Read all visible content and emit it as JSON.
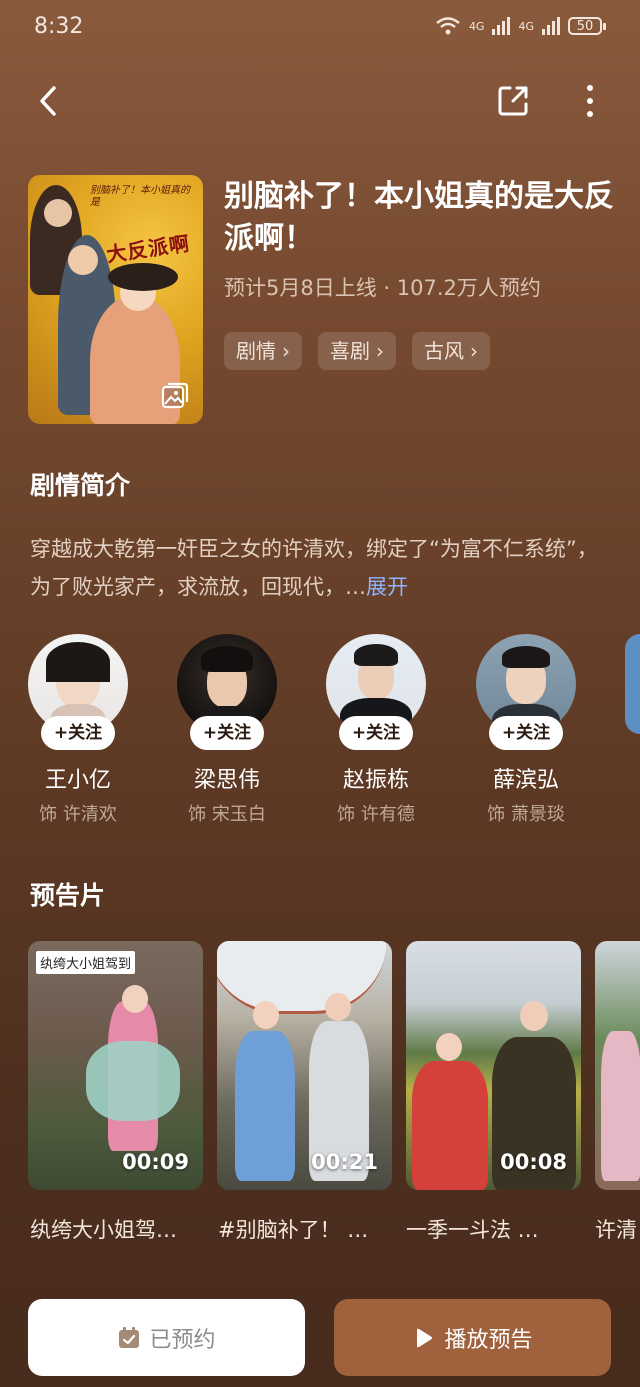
{
  "status_bar": {
    "time": "8:32",
    "net1": "4G",
    "net2": "4G",
    "battery": "50"
  },
  "header": {
    "back_icon": "chevron-left-icon",
    "share_icon": "share-icon",
    "more_icon": "more-vertical-icon"
  },
  "show": {
    "poster_caption": "别脑补了！本小姐真的是",
    "poster_title": "大反派啊",
    "title": "别脑补了！本小姐真的是大反派啊！",
    "meta": "预计5月8日上线 · 107.2万人预约",
    "tags": [
      "剧情",
      "喜剧",
      "古风"
    ]
  },
  "synopsis": {
    "heading": "剧情简介",
    "text": "穿越成大乾第一奸臣之女的许清欢，绑定了“为富不仁系统”，为了败光家产，求流放，回现代，…",
    "expand": "展开"
  },
  "cast": [
    {
      "follow": "+关注",
      "name": "王小亿",
      "role": "饰 许清欢"
    },
    {
      "follow": "+关注",
      "name": "梁思伟",
      "role": "饰 宋玉白"
    },
    {
      "follow": "+关注",
      "name": "赵振栋",
      "role": "饰 许有德"
    },
    {
      "follow": "+关注",
      "name": "薛滨弘",
      "role": "饰 萧景琰"
    }
  ],
  "trailers": {
    "heading": "预告片",
    "items": [
      {
        "badge": "纨绔大小姐驾到",
        "duration": "00:09",
        "caption": "纨绔大小姐驾…"
      },
      {
        "badge": "",
        "duration": "00:21",
        "caption": "#别脑补了！ …"
      },
      {
        "badge": "",
        "duration": "00:08",
        "caption": "一季一斗法 …"
      },
      {
        "badge": "",
        "duration": "",
        "caption": "许清"
      }
    ]
  },
  "bottom_bar": {
    "reserved_label": "已预约",
    "play_label": "播放预告"
  },
  "colors": {
    "accent": "#a0613d",
    "link": "#8fb3ff"
  }
}
